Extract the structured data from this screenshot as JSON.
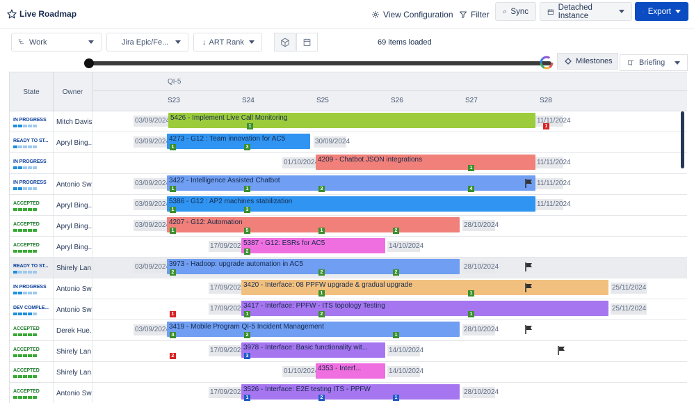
{
  "app": {
    "title": "Live Roadmap"
  },
  "toolbar": {
    "view_config": "View Configuration",
    "filter": "Filter",
    "sync": "Sync",
    "detached": "Detached Instance",
    "export": "Export"
  },
  "filters": {
    "work": "Work",
    "epic": "Jira Epic/Fe...",
    "rank": "ART Rank",
    "items_loaded": "69 items loaded"
  },
  "timeline_controls": {
    "milestones": "Milestones",
    "briefing": "Briefing"
  },
  "columns": {
    "state": "State",
    "owner": "Owner"
  },
  "pi": "QI-5",
  "sprints": [
    "S23",
    "S24",
    "S25",
    "S26",
    "S27",
    "S28"
  ],
  "colors": {
    "green": "#9ccc3b",
    "blue": "#2f94f2",
    "red": "#f08079",
    "periwinkle": "#6f9ef2",
    "pink": "#f06fe0",
    "orange": "#f2c07e",
    "violet": "#a676f0",
    "badge_green": "#3b8f2d",
    "badge_blue": "#1f5bc7",
    "badge_red": "#d92323"
  },
  "rows": [
    {
      "state": "IN PROGRESS",
      "state_kind": "progress",
      "owner": "Mitch Davis",
      "start": "03/09/2024",
      "end": "11/11/2024",
      "title": "5426 - Implement Live Call Monitoring"
    },
    {
      "state": "READY TO ST...",
      "state_kind": "ready",
      "owner": "Apryl Bing...",
      "start": "03/09/2024",
      "end": "30/09/2024",
      "title": "4273 - G12 : Team innovation for AC5"
    },
    {
      "state": "IN PROGRESS",
      "state_kind": "progress",
      "owner": "",
      "start": "01/10/2024",
      "end": "11/11/2024",
      "title": "4209 - Chatbot JSON integrations"
    },
    {
      "state": "IN PROGRESS",
      "state_kind": "progress",
      "owner": "Antonio Sw...",
      "start": "03/09/2024",
      "end": "11/11/2024",
      "title": "3422 - Intelligence Assisted Chatbot"
    },
    {
      "state": "ACCEPTED",
      "state_kind": "accepted",
      "owner": "Apryl Bing...",
      "start": "03/09/2024",
      "end": "11/11/2024",
      "title": "5386 - G12 : AP2 machines stabilization"
    },
    {
      "state": "ACCEPTED",
      "state_kind": "accepted",
      "owner": "Apryl Bing...",
      "start": "03/09/2024",
      "end": "28/10/2024",
      "title": "4207 - G12: Automation"
    },
    {
      "state": "ACCEPTED",
      "state_kind": "accepted",
      "owner": "Apryl Bing...",
      "start": "17/09/2024",
      "end": "14/10/2024",
      "title": "5387 - G12: ESRs for AC5"
    },
    {
      "state": "READY TO ST...",
      "state_kind": "ready",
      "owner": "Shirely Lan...",
      "start": "03/09/2024",
      "end": "28/10/2024",
      "title": "3973 - Hadoop: upgrade automation in AC5"
    },
    {
      "state": "IN PROGRESS",
      "state_kind": "progress",
      "owner": "Antonio Sw...",
      "start": "17/09/2024",
      "end": "25/11/2024",
      "title": "3420 - Interface: 08 PPFW upgrade & gradual upgrade"
    },
    {
      "state": "DEV COMPLE...",
      "state_kind": "dev",
      "owner": "Antonio Sw...",
      "start": "17/09/2024",
      "end": "25/11/2024",
      "title": "3417 - Interface: PPFW - ITS topology Testing"
    },
    {
      "state": "ACCEPTED",
      "state_kind": "accepted",
      "owner": "Derek Hue...",
      "start": "03/09/2024",
      "end": "28/10/2024",
      "title": "3419 - Mobile Program QI-5 Incident Management"
    },
    {
      "state": "ACCEPTED",
      "state_kind": "accepted",
      "owner": "Shirely Lan...",
      "start": "17/09/2024",
      "end": "14/10/2024",
      "title": "3978 - Interface: Basic functionality wit..."
    },
    {
      "state": "ACCEPTED",
      "state_kind": "accepted",
      "owner": "Shirely Lan...",
      "start": "01/10/2024",
      "end": "14/10/2024",
      "title": "4353 - Interf..."
    },
    {
      "state": "ACCEPTED",
      "state_kind": "accepted",
      "owner": "Antonio Sw...",
      "start": "17/09/2024",
      "end": "28/10/2024",
      "title": "3526 - Interface: E2E testing ITS - PPFW"
    }
  ]
}
